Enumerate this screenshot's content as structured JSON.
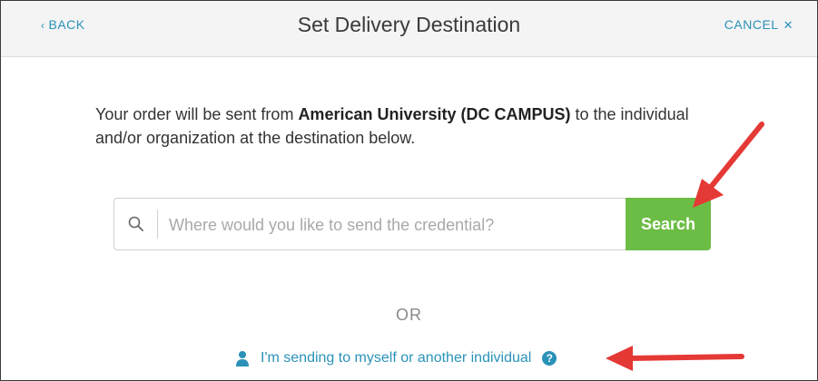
{
  "header": {
    "back_label": "BACK",
    "title": "Set Delivery Destination",
    "cancel_label": "CANCEL"
  },
  "intro": {
    "prefix": "Your order will be sent from ",
    "sender": "American University (DC CAMPUS)",
    "suffix": " to the individual and/or organization at the destination below."
  },
  "search": {
    "placeholder": "Where would you like to send the credential?",
    "value": "",
    "button_label": "Search"
  },
  "or_label": "OR",
  "myself_link": {
    "label": "I'm sending to myself or another individual",
    "help_glyph": "?"
  },
  "icons": {
    "back": "chevron-left-icon",
    "cancel": "close-icon",
    "search": "search-icon",
    "person": "person-icon",
    "help": "help-circle-icon",
    "annotation": "red-arrow-icon"
  },
  "colors": {
    "link": "#2a92b8",
    "search_button": "#6cbd45",
    "header_bg": "#f4f4f4",
    "annotation_arrow": "#e53935"
  }
}
